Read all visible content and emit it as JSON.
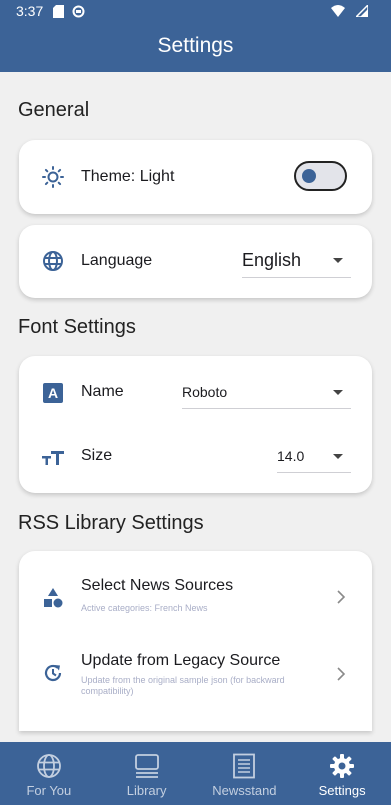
{
  "status_bar": {
    "time": "3:37"
  },
  "header": {
    "title": "Settings"
  },
  "sections": {
    "general": "General",
    "font": "Font Settings",
    "rss": "RSS Library Settings"
  },
  "general": {
    "theme_label": "Theme:  Light",
    "theme_toggle_on": false,
    "language_label": "Language",
    "language_value": "English"
  },
  "font_settings": {
    "name_label": "Name",
    "name_value": "Roboto",
    "size_label": "Size",
    "size_value": "14.0"
  },
  "rss": {
    "select_title": "Select News Sources",
    "select_sub": "Active categories: French News",
    "update_title": "Update from Legacy Source",
    "update_sub": "Update from the original sample json (for backward compatibility)"
  },
  "nav": [
    {
      "label": "For You",
      "icon": "globe-icon"
    },
    {
      "label": "Library",
      "icon": "library-icon"
    },
    {
      "label": "Newsstand",
      "icon": "newspaper-icon"
    },
    {
      "label": "Settings",
      "icon": "gear-icon"
    }
  ],
  "colors": {
    "primary": "#3c6397",
    "background": "#f0f0f0",
    "card": "#ffffff"
  }
}
